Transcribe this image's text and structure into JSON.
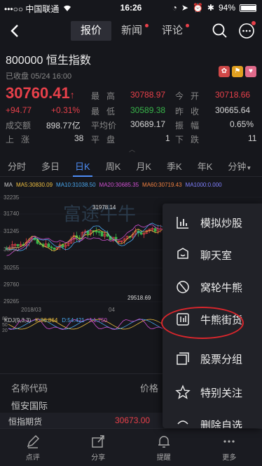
{
  "status_bar": {
    "carrier": "•••○○ 中国联通",
    "time": "16:26",
    "battery": "94%",
    "battery_level": 0.94
  },
  "nav": {
    "tabs": [
      {
        "label": "报价",
        "has_dot": false
      },
      {
        "label": "新闻",
        "has_dot": true
      },
      {
        "label": "评论",
        "has_dot": true
      }
    ]
  },
  "stock": {
    "title": "800000 恒生指数",
    "status": "已收盘 05/24 16:00",
    "price": "30760.41",
    "change": "+94.77",
    "change_pct": "+0.31%"
  },
  "quote": {
    "high_label": "最高",
    "high": "30788.97",
    "open_label": "今开",
    "open": "30718.66",
    "low_label": "最低",
    "low": "30589.38",
    "prev_close_label": "昨收",
    "prev_close": "30665.64",
    "turnover_label": "成交额",
    "turnover": "898.77亿",
    "avg_label": "平均价",
    "avg": "30689.17",
    "amplitude_label": "振幅",
    "amplitude": "0.65%",
    "up_label": "上涨",
    "up": "38",
    "flat_label": "平盘",
    "flat": "1",
    "down_label": "下跌",
    "down": "11"
  },
  "periods": [
    "分时",
    "多日",
    "日K",
    "周K",
    "月K",
    "季K",
    "年K",
    "分钟"
  ],
  "ma": [
    {
      "label": "MA",
      "color": "#cccccc"
    },
    {
      "label": "MA5:30830.09",
      "color": "#f0c040"
    },
    {
      "label": "MA10:31038.50",
      "color": "#4aa8f0"
    },
    {
      "label": "MA20:30685.35",
      "color": "#d050d0"
    },
    {
      "label": "MA60:30719.43",
      "color": "#f08040"
    },
    {
      "label": "MA1000:0.000",
      "color": "#8080ff"
    }
  ],
  "chart": {
    "y_ticks": [
      "32235",
      "31740",
      "31245",
      "30750",
      "30255",
      "29760",
      "29265"
    ],
    "x_ticks": [
      "2018/03",
      "04"
    ],
    "annotations": [
      "31978.14",
      "29518.69"
    ],
    "watermark": "富途牛牛"
  },
  "kdj": [
    {
      "label": "KDJ(9,3,3)",
      "color": "#cccccc"
    },
    {
      "label": "K:36.864",
      "color": "#f0c040"
    },
    {
      "label": "D:54.421",
      "color": "#4aa8f0"
    },
    {
      "label": "J:1.750",
      "color": "#d050d0"
    }
  ],
  "kdj_ticks": [
    "80",
    "50",
    "20"
  ],
  "list": {
    "col_name": "名称代码",
    "col_price": "价格",
    "partial_row": "恒安国际"
  },
  "bottom_strip": {
    "name": "恒指期货",
    "price": "30673.00"
  },
  "toolbar": [
    {
      "label": "点评",
      "icon": "comment-icon"
    },
    {
      "label": "分享",
      "icon": "share-icon"
    },
    {
      "label": "提醒",
      "icon": "bell-icon"
    },
    {
      "label": "更多",
      "icon": "more-icon"
    }
  ],
  "menu": [
    {
      "label": "模拟炒股",
      "icon": "chart-bars-icon"
    },
    {
      "label": "聊天室",
      "icon": "chat-icon"
    },
    {
      "label": "窝轮牛熊",
      "icon": "warrant-icon"
    },
    {
      "label": "牛熊街货",
      "icon": "bull-bear-icon"
    },
    {
      "label": "股票分组",
      "icon": "group-icon"
    },
    {
      "label": "特别关注",
      "icon": "star-icon"
    },
    {
      "label": "删除自选",
      "icon": "delete-icon"
    }
  ],
  "colors": {
    "up": "#e8404a",
    "down": "#38b54a",
    "accent": "#4d8df5",
    "bg": "#16171c"
  }
}
